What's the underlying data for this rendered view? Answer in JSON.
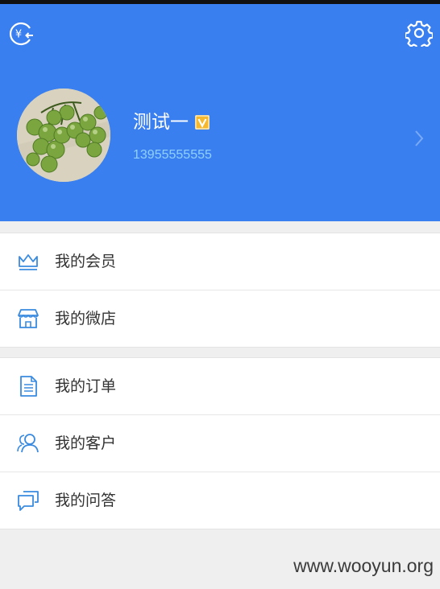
{
  "header": {
    "bg_color": "#3a7ff0",
    "left_icon": "yuan-exchange-icon",
    "right_icon": "gear-icon"
  },
  "profile": {
    "name": "测试一",
    "badge_icon": "vip-v-badge-icon",
    "phone": "13955555555",
    "avatar": "grapes-photo"
  },
  "menu": {
    "group1": [
      {
        "label": "我的会员",
        "icon": "crown-icon"
      },
      {
        "label": "我的微店",
        "icon": "store-icon"
      }
    ],
    "group2": [
      {
        "label": "我的订单",
        "icon": "document-icon"
      },
      {
        "label": "我的客户",
        "icon": "users-icon"
      },
      {
        "label": "我的问答",
        "icon": "chat-icon"
      }
    ]
  },
  "watermark": "www.wooyun.org"
}
